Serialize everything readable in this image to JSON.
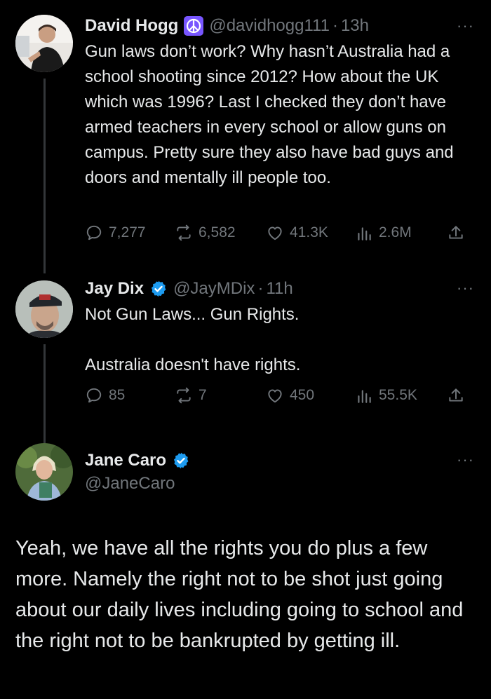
{
  "tweets": [
    {
      "name": "David Hogg",
      "handle": "@davidhogg111",
      "separator": "·",
      "time": "13h",
      "badge": "peace-sign-icon",
      "text": "Gun laws don’t work? Why hasn’t Australia had a school shooting since 2012? How about the UK which was 1996? Last I checked they don’t have armed teachers in every school or allow guns on campus. Pretty sure they also have bad guys and doors and mentally ill people too.",
      "stats": {
        "replies": "7,277",
        "retweets": "6,582",
        "likes": "41.3K",
        "views": "2.6M"
      }
    },
    {
      "name": "Jay Dix",
      "handle": "@JayMDix",
      "separator": "·",
      "time": "11h",
      "badge": "verified-icon",
      "text": "Not Gun Laws... Gun Rights.\n\nAustralia doesn't have rights.",
      "stats": {
        "replies": "85",
        "retweets": "7",
        "likes": "450",
        "views": "55.5K"
      }
    },
    {
      "name": "Jane Caro",
      "handle": "@JaneCaro",
      "badge": "verified-icon",
      "text": "Yeah, we have all the rights you do plus a few more. Namely the right not to be shot just going about our daily lives including going to school and the right not to be bankrupted by getting ill."
    }
  ],
  "more_label": "···",
  "colors": {
    "background": "#000000",
    "text": "#e7e9ea",
    "muted": "#71767b",
    "verified": "#1d9bf0",
    "peace": "#7856ff"
  }
}
